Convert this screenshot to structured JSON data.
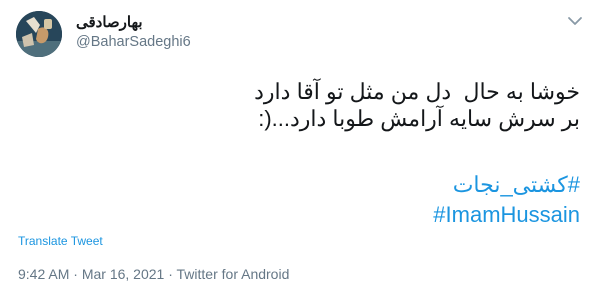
{
  "author": {
    "display_name": "بهارصادقی",
    "handle": "@BaharSadeghi6"
  },
  "tweet": {
    "lines": [
      "خوشا به حال  دل من مثل تو آقا دارد",
      "بر سرش سایه آرامش طوبا دارد...(:"
    ],
    "hashtags": [
      "#کشتی_نجات",
      "#ImamHussain"
    ]
  },
  "translate_label": "Translate Tweet",
  "meta": {
    "time": "9:42 AM",
    "sep1": " · ",
    "date": "Mar 16, 2021",
    "sep2": " · ",
    "source": "Twitter for Android"
  },
  "icons": {
    "menu": "chevron-down-icon"
  },
  "colors": {
    "link": "#1b95e0",
    "text": "#14171a",
    "muted": "#657786"
  }
}
